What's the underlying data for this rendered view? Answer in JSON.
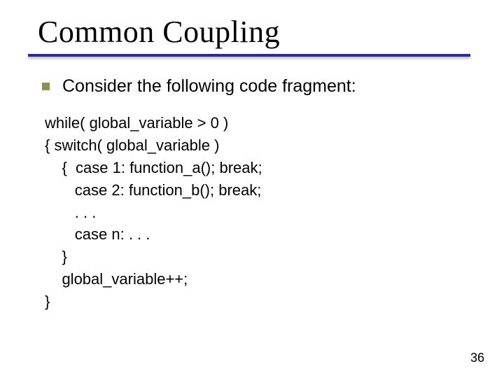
{
  "slide": {
    "title": "Common Coupling",
    "bullet": "Consider the following code fragment:",
    "code": {
      "l0": "while( global_variable > 0 )",
      "l1": "{ switch( global_variable )",
      "l2": "    {  case 1: function_a(); break;",
      "l3": "       case 2: function_b(); break;",
      "l4": "       . . .",
      "l5": "       case n: . . .",
      "l6": "    }",
      "l7": "    global_variable++;",
      "l8": "}"
    },
    "page_number": "36"
  }
}
